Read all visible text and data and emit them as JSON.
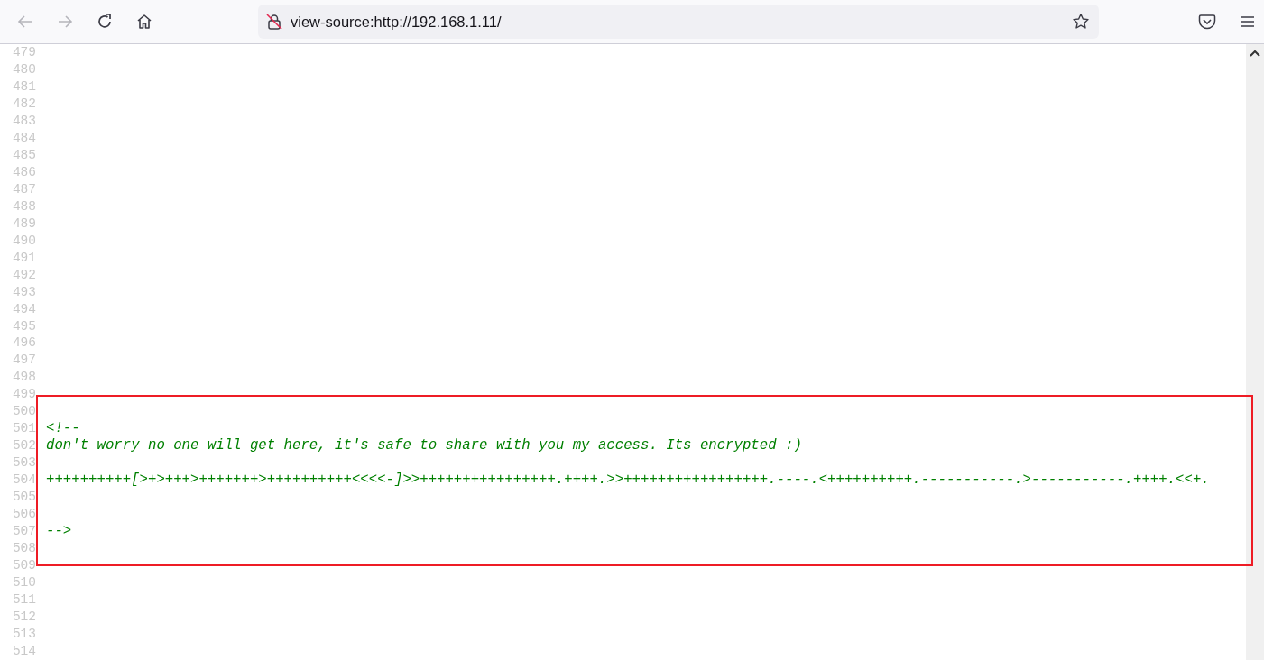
{
  "toolbar": {
    "nav_buttons": [
      {
        "kind": "back",
        "disabled": true
      },
      {
        "kind": "forward",
        "disabled": true
      },
      {
        "kind": "reload",
        "disabled": false
      },
      {
        "kind": "home",
        "disabled": false
      }
    ],
    "url": "view-source:http://192.168.1.11/",
    "secure": false
  },
  "source": {
    "sections": [
      {
        "highlighted": false,
        "lines": [
          {
            "number": "479"
          },
          {
            "number": "480"
          },
          {
            "number": "481"
          },
          {
            "number": "482"
          },
          {
            "number": "483"
          },
          {
            "number": "484"
          },
          {
            "number": "485"
          },
          {
            "number": "486"
          },
          {
            "number": "487"
          },
          {
            "number": "488"
          },
          {
            "number": "489"
          },
          {
            "number": "490"
          },
          {
            "number": "491"
          },
          {
            "number": "492"
          },
          {
            "number": "493"
          },
          {
            "number": "494"
          },
          {
            "number": "495"
          },
          {
            "number": "496"
          },
          {
            "number": "497"
          },
          {
            "number": "498"
          },
          {
            "number": "499"
          }
        ]
      },
      {
        "highlighted": true,
        "lines": [
          {
            "number": "500"
          },
          {
            "number": "501",
            "text": "<!--"
          },
          {
            "number": "502",
            "text": "don't worry no one will get here, it's safe to share with you my access. Its encrypted :)"
          },
          {
            "number": "503"
          },
          {
            "number": "504",
            "text": "++++++++++[>+>+++>+++++++>++++++++++<<<<-]>>++++++++++++++++.++++.>>+++++++++++++++++.----.<++++++++++.-----------.>-----------.++++.<<+."
          },
          {
            "number": "505"
          },
          {
            "number": "506"
          },
          {
            "number": "507",
            "text": "-->"
          },
          {
            "number": "508"
          },
          {
            "number": "509"
          }
        ]
      },
      {
        "highlighted": false,
        "lines": [
          {
            "number": "510"
          },
          {
            "number": "511"
          },
          {
            "number": "512"
          },
          {
            "number": "513"
          },
          {
            "number": "514"
          }
        ]
      }
    ]
  }
}
